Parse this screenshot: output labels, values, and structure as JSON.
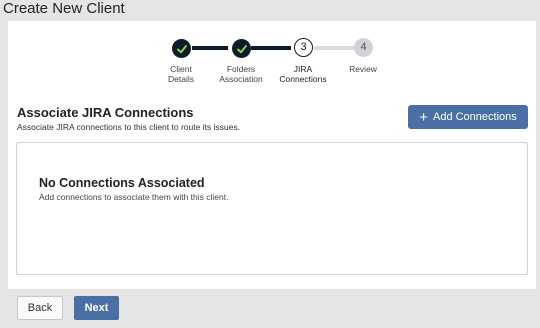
{
  "page": {
    "title": "Create New Client"
  },
  "stepper": {
    "steps": [
      {
        "label_line1": "Client",
        "label_line2": "Details",
        "state": "completed",
        "icon": "check-icon"
      },
      {
        "label_line1": "Folders",
        "label_line2": "Association",
        "state": "completed",
        "icon": "check-icon"
      },
      {
        "label_line1": "JIRA",
        "label_line2": "Connections",
        "state": "current",
        "number": "3"
      },
      {
        "label_line1": "Review",
        "label_line2": "",
        "state": "upcoming",
        "number": "4"
      }
    ]
  },
  "section": {
    "title": "Associate JIRA Connections",
    "description": "Associate JIRA connections to this client to route its issues.",
    "add_button_label": "Add Connections",
    "add_button_icon": "plus-icon"
  },
  "connections": {
    "empty_title": "No Connections Associated",
    "empty_description": "Add connections to associate them with this client."
  },
  "footer": {
    "back_label": "Back",
    "next_label": "Next"
  },
  "colors": {
    "primary": "#4a6fa5",
    "step_done": "#0d1b2a",
    "check": "#8bd34a",
    "step_future": "#cfd3d8",
    "page_bg": "#e5e5e5"
  }
}
